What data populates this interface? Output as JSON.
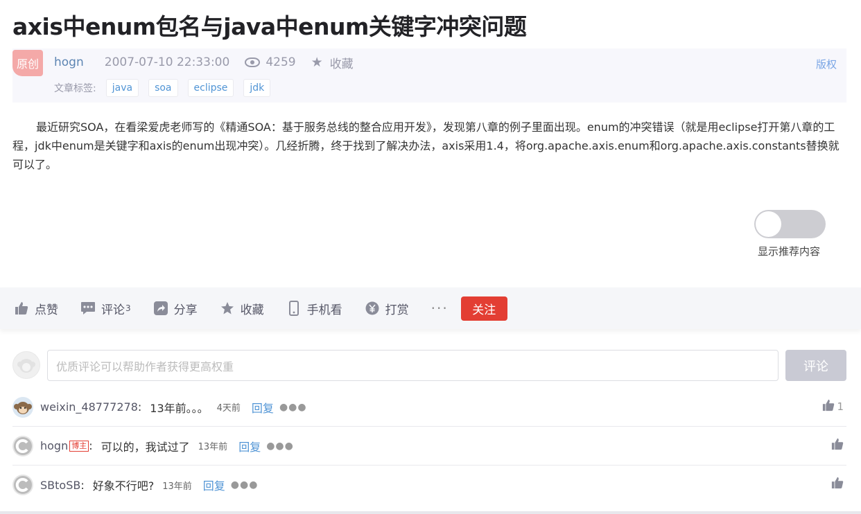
{
  "article": {
    "title": "axis中enum包名与java中enum关键字冲突问题",
    "original_badge": "原创",
    "author": "hogn",
    "date": "2007-07-10 22:33:00",
    "views": "4259",
    "favorite_label": "收藏",
    "copyright_label": "版权",
    "tags_label": "文章标签:",
    "tags": [
      "java",
      "soa",
      "eclipse",
      "jdk"
    ],
    "body": "最近研究SOA，在看梁爱虎老师写的《精通SOA：基于服务总线的整合应用开发》，发现第八章的例子里面出现。enum的冲突错误（就是用eclipse打开第八章的工程，jdk中enum是关键字和axis的enum出现冲突）。几经折腾，终于找到了解决办法，axis采用1.4，将org.apache.axis.enum和org.apache.axis.constants替换就可以了。"
  },
  "recommend_toggle": {
    "label": "显示推荐内容",
    "on": false
  },
  "actions": {
    "like": "点赞",
    "comment": "评论",
    "comment_count": "3",
    "share": "分享",
    "favorite": "收藏",
    "mobile": "手机看",
    "reward": "打赏",
    "more": "···",
    "follow": "关注"
  },
  "comment_box": {
    "placeholder": "优质评论可以帮助作者获得更高权重",
    "submit": "评论"
  },
  "comments": [
    {
      "user": "weixin_48777278",
      "is_host": false,
      "text": "13年前。。。",
      "time": "4天前",
      "reply": "回复",
      "likes": "1"
    },
    {
      "user": "hogn",
      "is_host": true,
      "host_badge": "博主",
      "text": "可以的，我试过了",
      "time": "13年前",
      "reply": "回复",
      "likes": ""
    },
    {
      "user": "SBtoSB",
      "is_host": false,
      "text": "好象不行吧?",
      "time": "13年前",
      "reply": "回复",
      "likes": ""
    }
  ],
  "colors": {
    "accent_red": "#e33e33",
    "link_blue": "#5094d5",
    "author_blue": "#5d85b3"
  }
}
